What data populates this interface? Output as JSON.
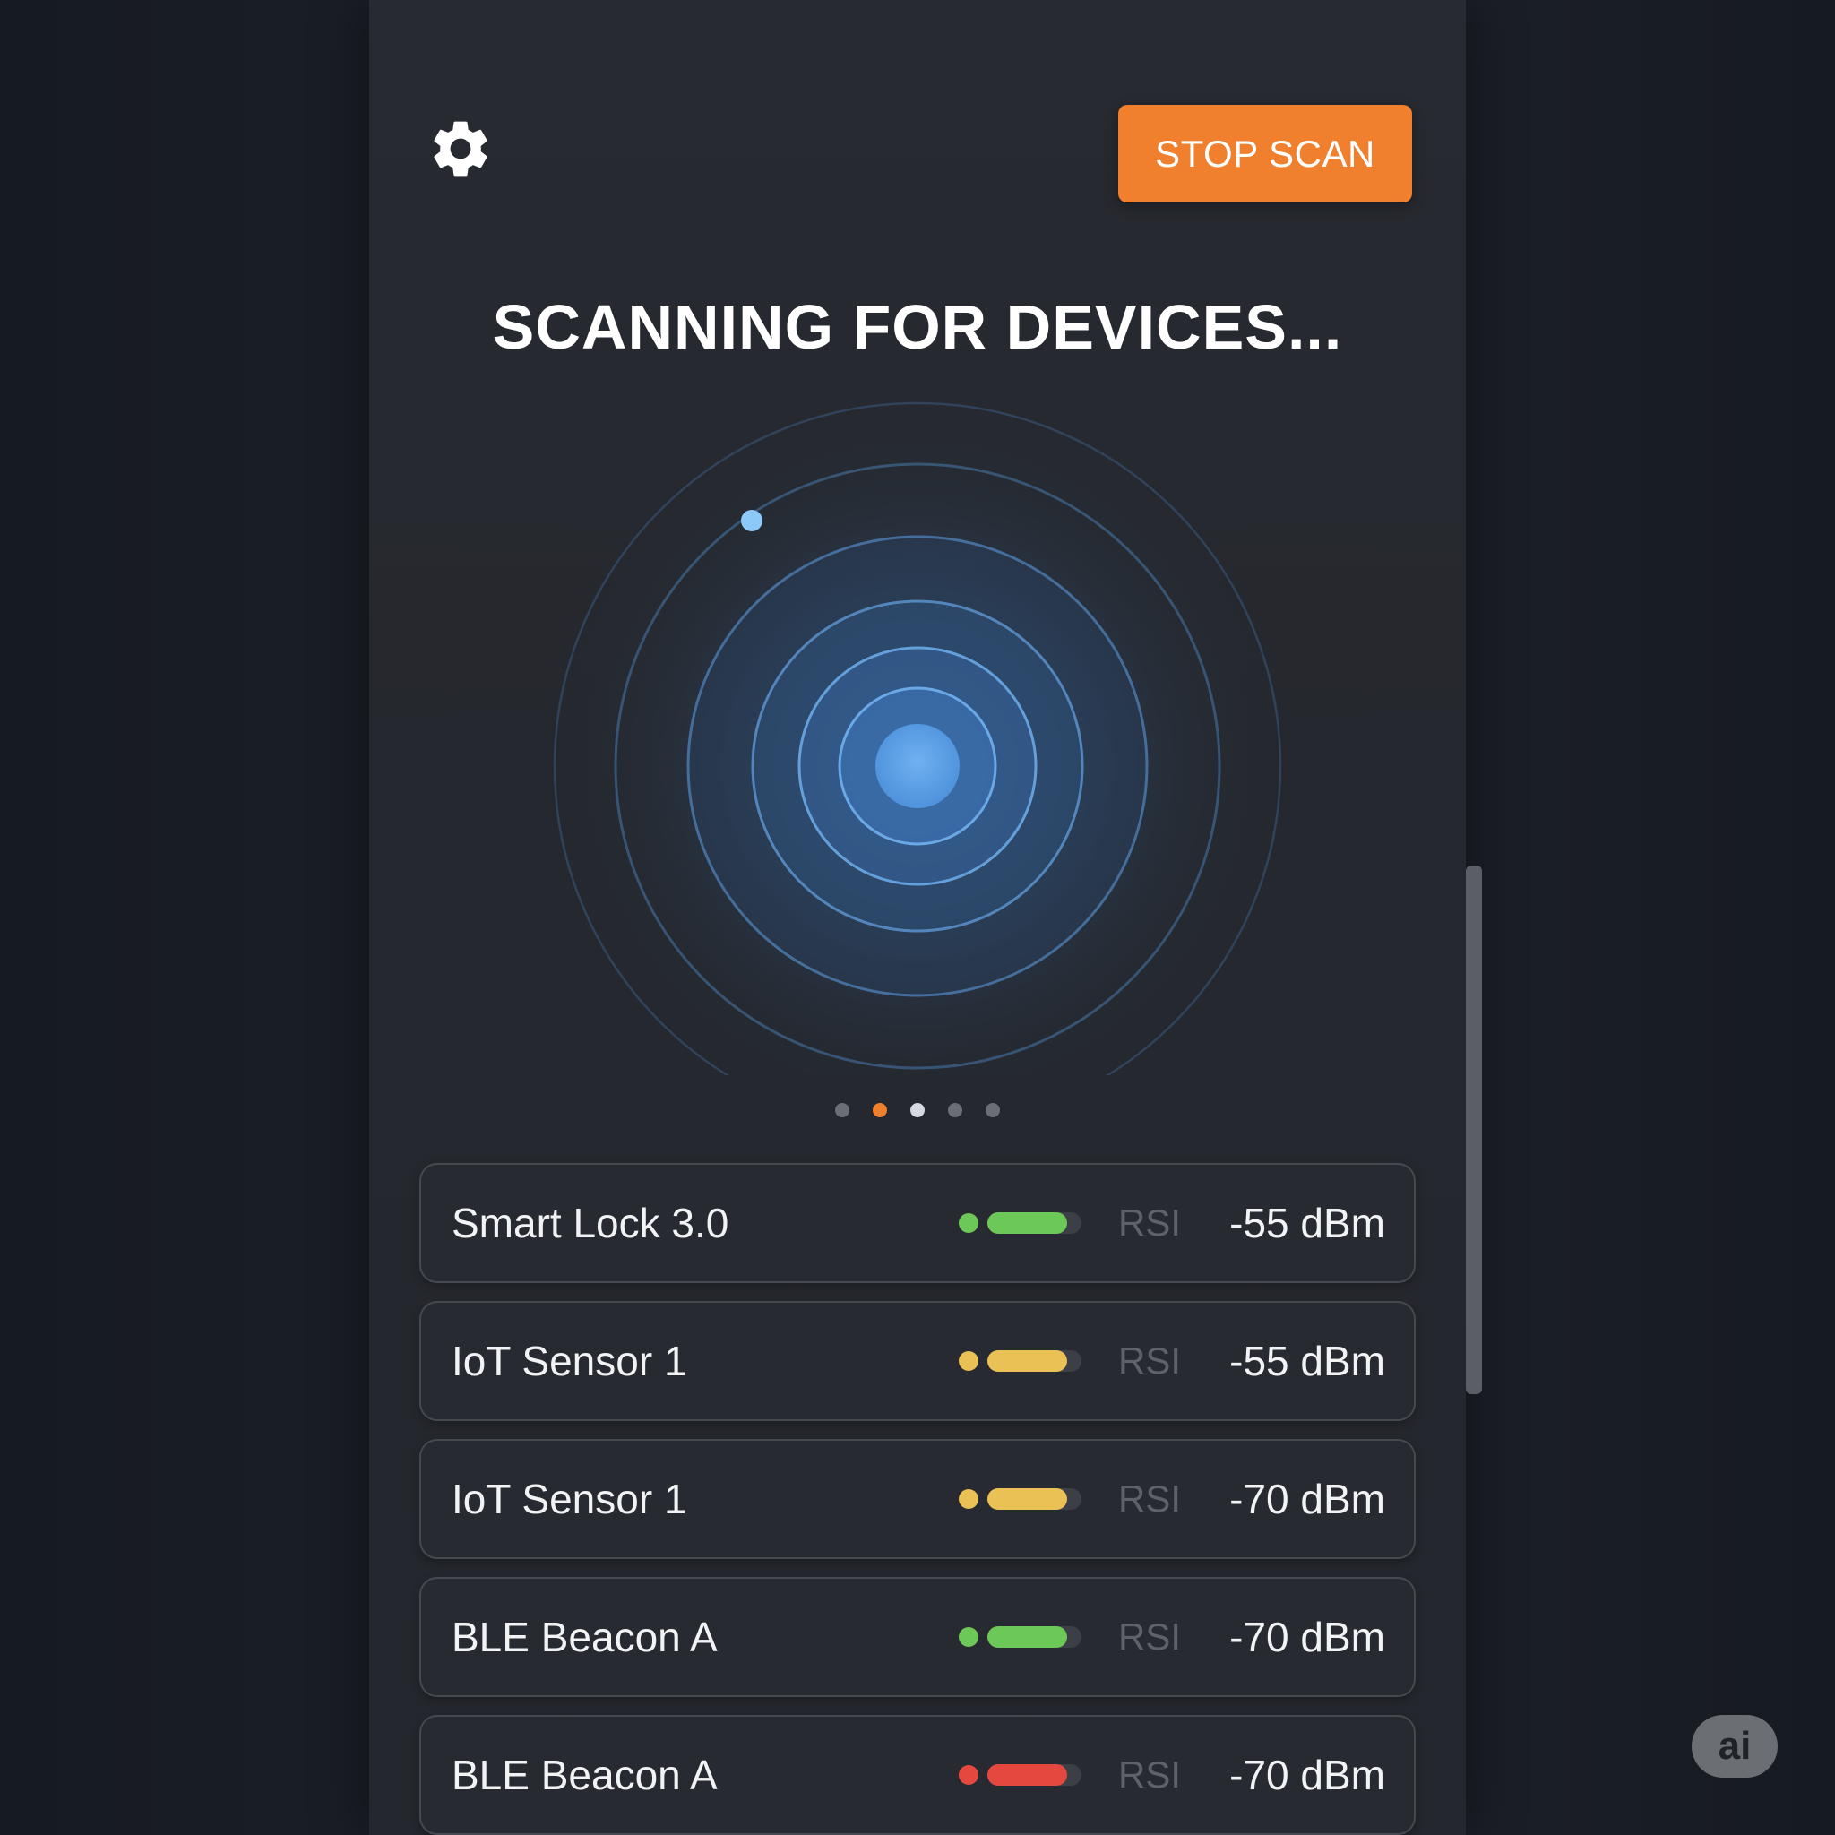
{
  "header": {
    "settings_icon": "gear-icon",
    "stop_scan_label": "STOP SCAN",
    "accent_color": "#f07f2e"
  },
  "scan": {
    "title": "SCANNING FOR DEVICES...",
    "radar_color": "#5aa0e6"
  },
  "pagination": {
    "count": 5,
    "active_index": 1,
    "highlighted_index": 2
  },
  "devices": [
    {
      "name": "Smart Lock 3.0",
      "signal_label": "RSI",
      "dbm": "-55 dBm",
      "status_color": "#6cc857",
      "level": 0.85
    },
    {
      "name": "IoT Sensor 1",
      "signal_label": "RSI",
      "dbm": "-55 dBm",
      "status_color": "#eac154",
      "level": 0.85
    },
    {
      "name": "IoT Sensor 1",
      "signal_label": "RSI",
      "dbm": "-70 dBm",
      "status_color": "#eac154",
      "level": 0.85
    },
    {
      "name": "BLE Beacon A",
      "signal_label": "RSI",
      "dbm": "-70 dBm",
      "status_color": "#6cc857",
      "level": 0.85
    },
    {
      "name": "BLE Beacon A",
      "signal_label": "RSI",
      "dbm": "-70 dBm",
      "status_color": "#e5483e",
      "level": 0.85
    }
  ],
  "badge": {
    "text": "ai"
  }
}
